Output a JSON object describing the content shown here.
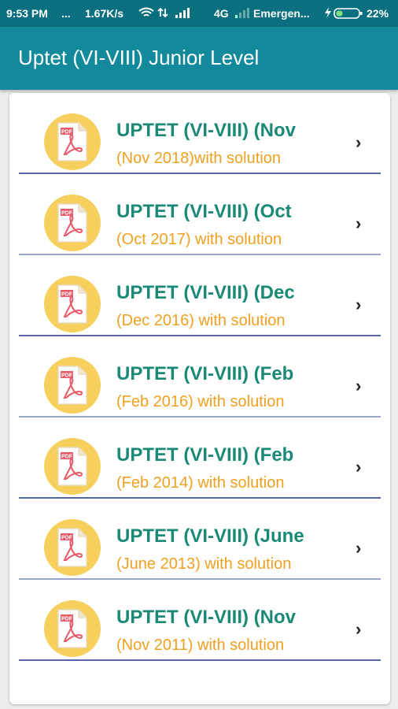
{
  "status_bar": {
    "time": "9:53 PM",
    "dots": "...",
    "speed": "1.67K/s",
    "network": "4G",
    "carrier": "Emergen...",
    "battery": "22%"
  },
  "app_bar": {
    "title": "Uptet (VI-VIII) Junior Level"
  },
  "pdf_icon_label": "PDF",
  "items": [
    {
      "title": "UPTET (VI-VIII) (Nov",
      "subtitle": "(Nov 2018)with solution"
    },
    {
      "title": "UPTET (VI-VIII) (Oct",
      "subtitle": "(Oct 2017) with solution"
    },
    {
      "title": "UPTET (VI-VIII) (Dec",
      "subtitle": "(Dec 2016) with solution"
    },
    {
      "title": "UPTET (VI-VIII) (Feb",
      "subtitle": "(Feb 2016) with solution"
    },
    {
      "title": "UPTET (VI-VIII) (Feb",
      "subtitle": "(Feb 2014) with solution"
    },
    {
      "title": "UPTET (VI-VIII) (June",
      "subtitle": "(June 2013) with solution"
    },
    {
      "title": "UPTET (VI-VIII) (Nov",
      "subtitle": "(Nov 2011) with solution"
    }
  ],
  "chevron": "›",
  "colors": {
    "status_bar": "#0a6f7f",
    "app_bar": "#128a9b",
    "title": "#1a8a76",
    "subtitle": "#f0a020",
    "icon_circle": "#f6cf5c",
    "divider": "#5563a8"
  }
}
